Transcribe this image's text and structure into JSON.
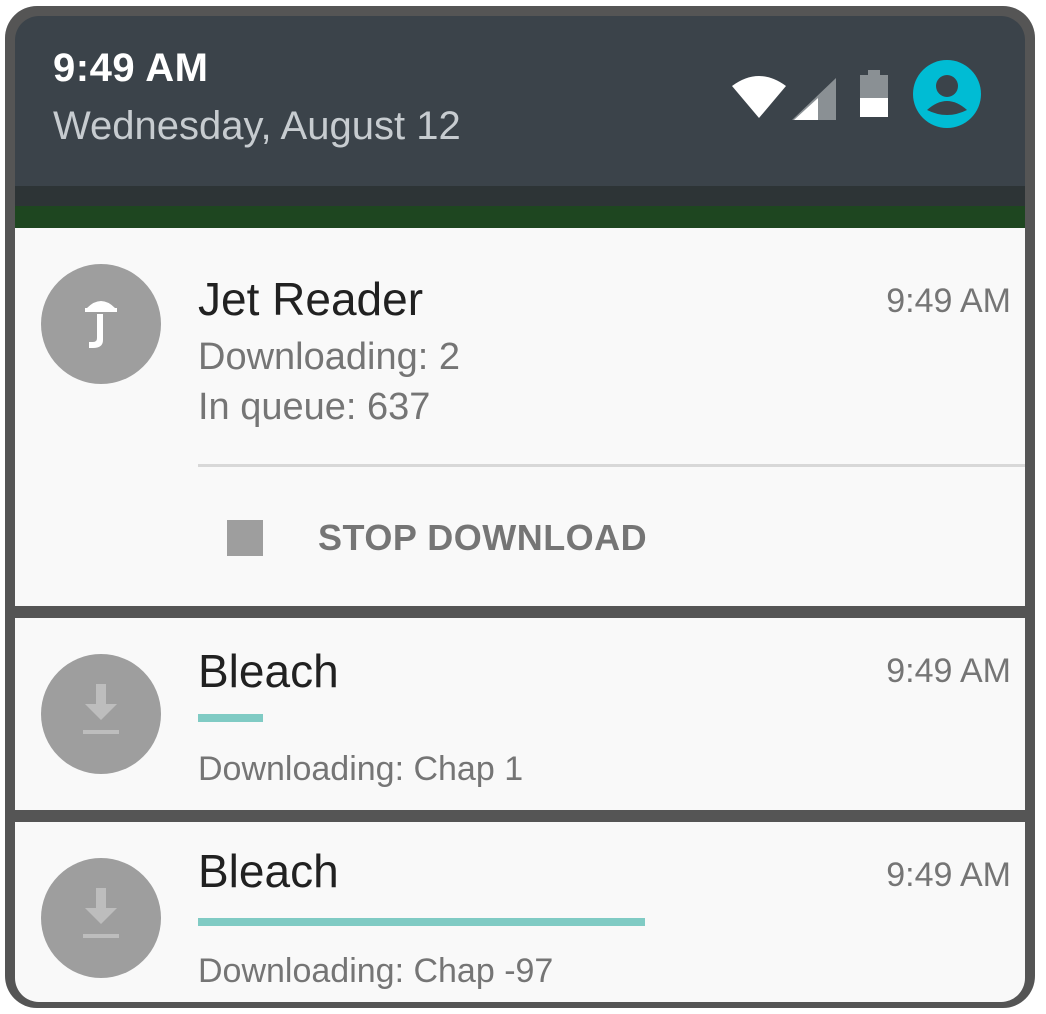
{
  "status_bar": {
    "time": "9:49 AM",
    "date": "Wednesday, August 12",
    "icons": [
      "wifi-icon",
      "cell-signal-icon",
      "battery-icon",
      "account-icon"
    ],
    "account_color": "#00bcd4"
  },
  "notifications": [
    {
      "app": "Jet Reader",
      "time": "9:49 AM",
      "lines": [
        "Downloading: 2",
        "In queue: 637"
      ],
      "action_label": "STOP DOWNLOAD",
      "icon": "jet-reader-logo-icon"
    },
    {
      "app": "Bleach",
      "time": "9:49 AM",
      "status": "Downloading: Chap 1",
      "progress": 0.08,
      "icon": "download-icon"
    },
    {
      "app": "Bleach",
      "time": "9:49 AM",
      "status": "Downloading: Chap -97",
      "progress": 0.55,
      "icon": "download-icon"
    }
  ],
  "colors": {
    "header_bg": "#3b434a",
    "card_bg": "#f9f9f9",
    "progress": "#80cbc4"
  }
}
